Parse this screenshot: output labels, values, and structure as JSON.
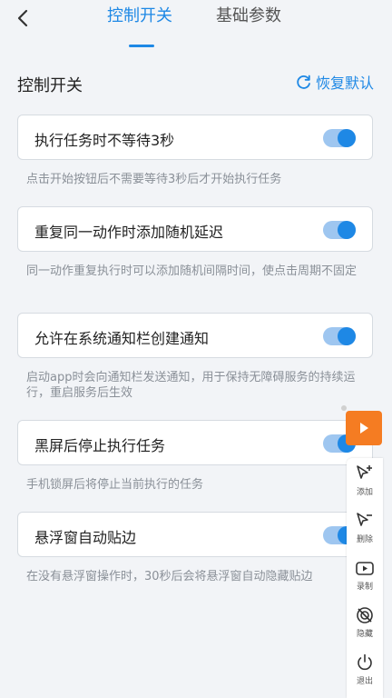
{
  "header": {
    "tabs": [
      {
        "label": "控制开关",
        "active": true
      },
      {
        "label": "基础参数",
        "active": false
      }
    ]
  },
  "section": {
    "title": "控制开关",
    "restore_label": "恢复默认"
  },
  "settings": [
    {
      "label": "执行任务时不等待3秒",
      "enabled": true,
      "description": "点击开始按钮后不需要等待3秒后才开始执行任务"
    },
    {
      "label": "重复同一动作时添加随机延迟",
      "enabled": true,
      "description": "同一动作重复执行时可以添加随机间隔时间，使点击周期不固定"
    },
    {
      "label": "允许在系统通知栏创建通知",
      "enabled": true,
      "description": "启动app时会向通知栏发送通知，用于保持无障碍服务的持续运行，重启服务后生效"
    },
    {
      "label": "黑屏后停止执行任务",
      "enabled": true,
      "description": "手机锁屏后将停止当前执行的任务"
    },
    {
      "label": "悬浮窗自动贴边",
      "enabled": true,
      "description": "在没有悬浮窗操作时，30秒后会将悬浮窗自动隐藏贴边"
    }
  ],
  "floating_toolbar": {
    "items": [
      {
        "label": "添加",
        "icon": "add-pointer-icon"
      },
      {
        "label": "删除",
        "icon": "remove-pointer-icon"
      },
      {
        "label": "录制",
        "icon": "record-icon"
      },
      {
        "label": "隐藏",
        "icon": "hide-icon"
      },
      {
        "label": "退出",
        "icon": "power-icon"
      }
    ]
  },
  "colors": {
    "accent": "#1e88e5",
    "play_button": "#f57c22",
    "background": "#f2f4f7"
  }
}
